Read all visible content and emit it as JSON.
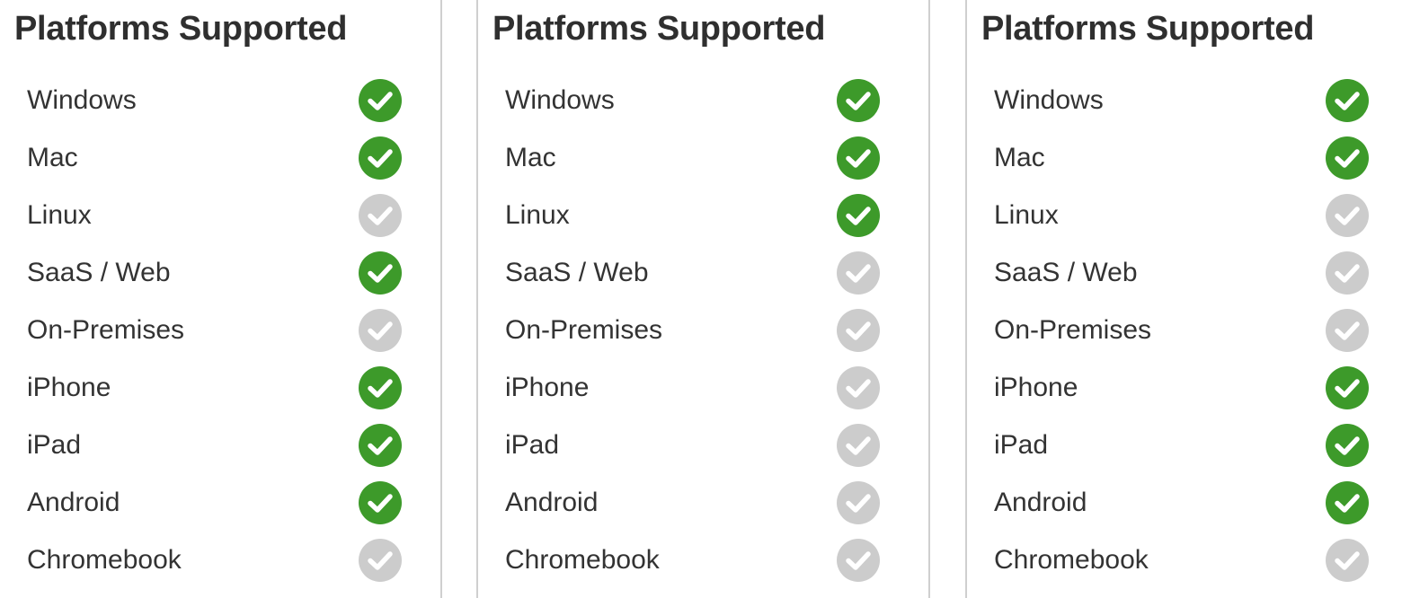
{
  "colors": {
    "supported": "#3d9a2a",
    "unsupported": "#cccccc",
    "divider": "#cfcfcf",
    "text": "#333333"
  },
  "icons": {
    "supported": "check-circle-green-icon",
    "unsupported": "check-circle-gray-icon"
  },
  "panels": [
    {
      "title": "Platforms Supported",
      "platforms": [
        {
          "name": "Windows",
          "supported": true
        },
        {
          "name": "Mac",
          "supported": true
        },
        {
          "name": "Linux",
          "supported": false
        },
        {
          "name": "SaaS / Web",
          "supported": true
        },
        {
          "name": "On-Premises",
          "supported": false
        },
        {
          "name": "iPhone",
          "supported": true
        },
        {
          "name": "iPad",
          "supported": true
        },
        {
          "name": "Android",
          "supported": true
        },
        {
          "name": "Chromebook",
          "supported": false
        }
      ]
    },
    {
      "title": "Platforms Supported",
      "platforms": [
        {
          "name": "Windows",
          "supported": true
        },
        {
          "name": "Mac",
          "supported": true
        },
        {
          "name": "Linux",
          "supported": true
        },
        {
          "name": "SaaS / Web",
          "supported": false
        },
        {
          "name": "On-Premises",
          "supported": false
        },
        {
          "name": "iPhone",
          "supported": false
        },
        {
          "name": "iPad",
          "supported": false
        },
        {
          "name": "Android",
          "supported": false
        },
        {
          "name": "Chromebook",
          "supported": false
        }
      ]
    },
    {
      "title": "Platforms Supported",
      "platforms": [
        {
          "name": "Windows",
          "supported": true
        },
        {
          "name": "Mac",
          "supported": true
        },
        {
          "name": "Linux",
          "supported": false
        },
        {
          "name": "SaaS / Web",
          "supported": false
        },
        {
          "name": "On-Premises",
          "supported": false
        },
        {
          "name": "iPhone",
          "supported": true
        },
        {
          "name": "iPad",
          "supported": true
        },
        {
          "name": "Android",
          "supported": true
        },
        {
          "name": "Chromebook",
          "supported": false
        }
      ]
    }
  ]
}
